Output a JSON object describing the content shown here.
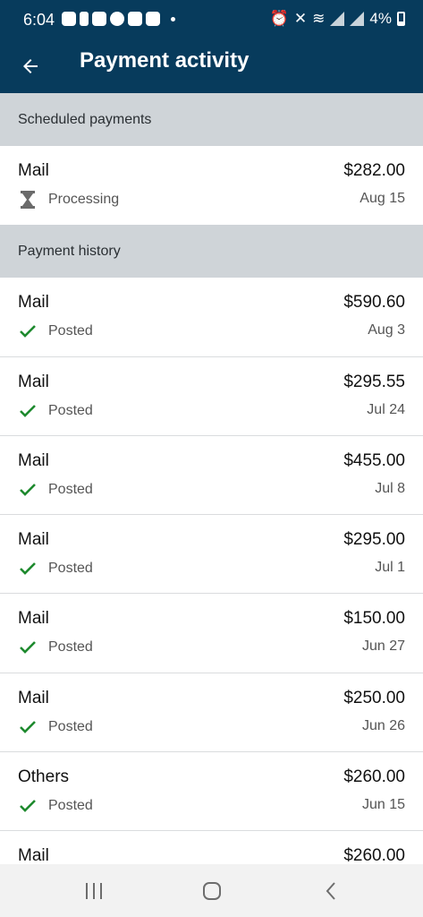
{
  "status_bar": {
    "time": "6:04",
    "battery": "4%"
  },
  "app_bar": {
    "title": "Payment activity"
  },
  "scheduled": {
    "header": "Scheduled payments",
    "items": [
      {
        "name": "Mail",
        "amount": "$282.00",
        "status": "Processing",
        "date": "Aug 15",
        "icon": "hourglass-icon"
      }
    ]
  },
  "history": {
    "header": "Payment history",
    "items": [
      {
        "name": "Mail",
        "amount": "$590.60",
        "status": "Posted",
        "date": "Aug 3",
        "icon": "check-icon"
      },
      {
        "name": "Mail",
        "amount": "$295.55",
        "status": "Posted",
        "date": "Jul 24",
        "icon": "check-icon"
      },
      {
        "name": "Mail",
        "amount": "$455.00",
        "status": "Posted",
        "date": "Jul 8",
        "icon": "check-icon"
      },
      {
        "name": "Mail",
        "amount": "$295.00",
        "status": "Posted",
        "date": "Jul 1",
        "icon": "check-icon"
      },
      {
        "name": "Mail",
        "amount": "$150.00",
        "status": "Posted",
        "date": "Jun 27",
        "icon": "check-icon"
      },
      {
        "name": "Mail",
        "amount": "$250.00",
        "status": "Posted",
        "date": "Jun 26",
        "icon": "check-icon"
      },
      {
        "name": "Others",
        "amount": "$260.00",
        "status": "Posted",
        "date": "Jun 15",
        "icon": "check-icon"
      },
      {
        "name": "Mail",
        "amount": "$260.00",
        "status": "",
        "date": "",
        "icon": ""
      }
    ]
  },
  "colors": {
    "header_bg": "#073b5c",
    "section_bg": "#cfd4d8",
    "check": "#1e8a2e"
  }
}
